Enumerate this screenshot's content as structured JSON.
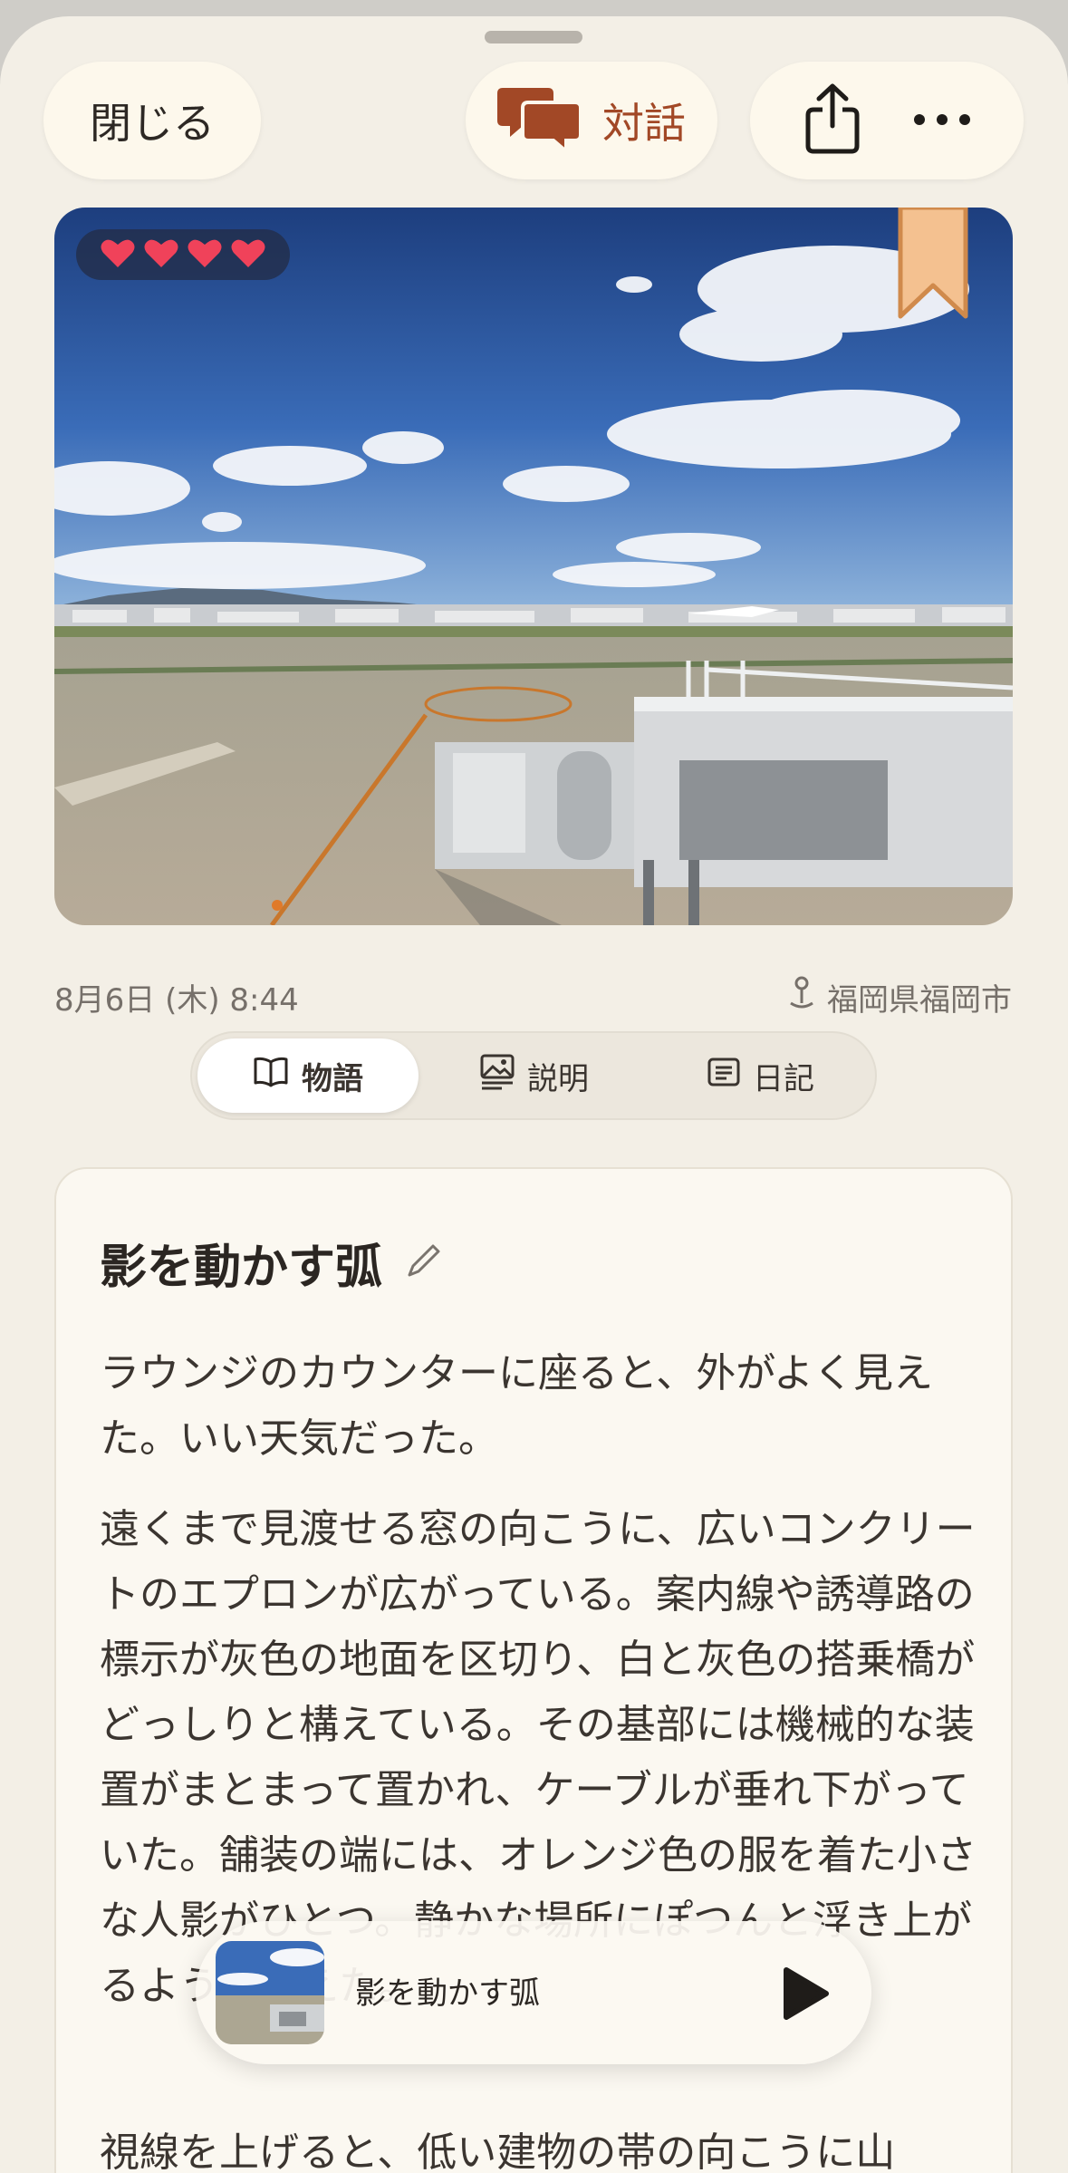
{
  "top_bar": {
    "close_label": "閉じる",
    "dialog_label": "対話"
  },
  "photo": {
    "rating": 4,
    "bookmark_color": "#f4c190",
    "icons": [
      "heart-icon",
      "bookmark-icon"
    ]
  },
  "meta": {
    "date": "8月6日 (木) 8:44",
    "location": "福岡県福岡市"
  },
  "tabs": [
    {
      "label": "物語",
      "icon": "book-icon",
      "active": true
    },
    {
      "label": "説明",
      "icon": "image-text-icon",
      "active": false
    },
    {
      "label": "日記",
      "icon": "journal-icon",
      "active": false
    }
  ],
  "story": {
    "title": "影を動かす弧",
    "paragraphs": [
      "ラウンジのカウンターに座ると、外がよく見えた。いい天気だった。",
      "遠くまで見渡せる窓の向こうに、広いコンクリートのエプロンが広がっている。案内線や誘導路の標示が灰色の地面を区切り、白と灰色の搭乗橋がどっしりと構えている。その基部には機械的な装置がまとまって置かれ、ケーブルが垂れ下がっていた。舗装の端には、オレンジ色の服を着た小さな人影がひとつ。静かな場所にぽつんと浮き上がるように見えた。",
      "視線を上げると、低い建物の帯の向こうに山"
    ]
  },
  "mini_player": {
    "title": "影を動かす弧"
  },
  "colors": {
    "accent": "#a24826",
    "background": "#f3efe6",
    "card": "#fbf8f1",
    "heart": "#f0425a"
  }
}
